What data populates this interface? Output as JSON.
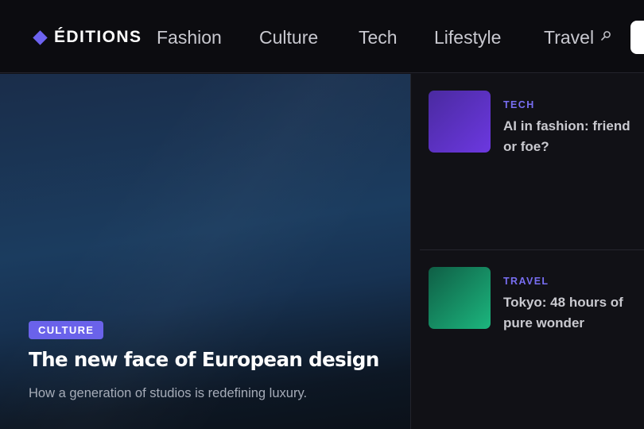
{
  "brand": {
    "name": "ÉDITIONS",
    "icon": "diamond-logo-icon",
    "accent": "#6d63f0"
  },
  "nav": {
    "items": [
      {
        "label": "Fashion"
      },
      {
        "label": "Culture"
      },
      {
        "label": "Tech"
      },
      {
        "label": "Lifestyle"
      },
      {
        "label": "Travel"
      }
    ],
    "search_icon": "search-icon"
  },
  "hero": {
    "category": "CULTURE",
    "title": "The new face of European design",
    "subtitle": "How a generation of studios is redefining luxury."
  },
  "side_cards": [
    {
      "category": "TECH",
      "title": "AI in fashion: friend or foe?",
      "thumb_color": "#6233c8"
    },
    {
      "category": "TRAVEL",
      "title": "Tokyo: 48 hours of pure wonder",
      "thumb_color": "#15936a"
    }
  ],
  "colors": {
    "background": "#111116",
    "topbar": "#0c0c10",
    "badge": "#6a62ea"
  }
}
